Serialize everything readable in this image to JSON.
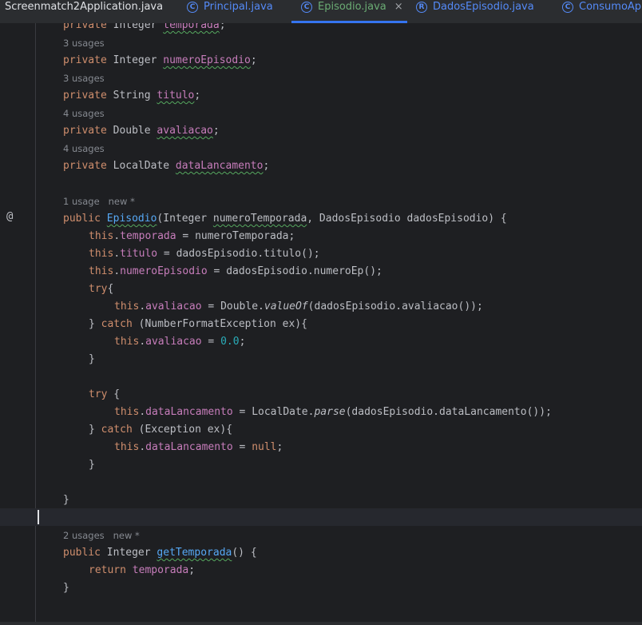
{
  "tabs": [
    {
      "label": "Screenmatch2Application.java",
      "icon": "",
      "state": "plain"
    },
    {
      "label": "Principal.java",
      "icon": "C",
      "state": "normal"
    },
    {
      "label": "Episodio.java",
      "icon": "C",
      "state": "active",
      "close": "×"
    },
    {
      "label": "DadosEpisodio.java",
      "icon": "R",
      "state": "normal"
    },
    {
      "label": "ConsumoApi",
      "icon": "C",
      "state": "normal"
    }
  ],
  "gutter": {
    "override_marker": "@"
  },
  "hints": {
    "u3": "3 usages",
    "u4": "4 usages",
    "ctor": "1 usage   new *",
    "getter": "2 usages   new *"
  },
  "code": {
    "l1_kw": "private",
    "l1_type": " Integer ",
    "l1_name": "temporada",
    "l1_end": ";",
    "l2_kw": "private",
    "l2_type": " Integer ",
    "l2_name": "numeroEpisodio",
    "l2_end": ";",
    "l3_kw": "private",
    "l3_type": " String ",
    "l3_name": "titulo",
    "l3_end": ";",
    "l4_kw": "private",
    "l4_type": " Double ",
    "l4_name": "avaliacao",
    "l4_end": ";",
    "l5_kw": "private",
    "l5_type": " LocalDate ",
    "l5_name": "dataLancamento",
    "l5_end": ";",
    "c_kw": "public",
    "c_sp": " ",
    "c_name": "Episodio",
    "c_p1": "(Integer ",
    "c_arg1": "numeroTemporada",
    "c_p2": ", DadosEpisodio dadosEpisodio) {",
    "a1_this": "this",
    "a1_dot": ".",
    "a1_fld": "temporada",
    "a1_rest": " = numeroTemporada;",
    "a2_this": "this",
    "a2_dot": ".",
    "a2_fld": "titulo",
    "a2_rest": " = dadosEpisodio.titulo();",
    "a3_this": "this",
    "a3_dot": ".",
    "a3_fld": "numeroEpisodio",
    "a3_rest": " = dadosEpisodio.numeroEp();",
    "try1": "try",
    "try1_b": "{",
    "t1_this": "this",
    "t1_dot": ".",
    "t1_fld": "avaliacao",
    "t1_a": " = Double.",
    "t1_m": "valueOf",
    "t1_rest": "(dadosEpisodio.avaliacao());",
    "catch1_a": "} ",
    "catch1_kw": "catch",
    "catch1_rest": " (NumberFormatException ex){",
    "cb1_this": "this",
    "cb1_dot": ".",
    "cb1_fld": "avaliacao",
    "cb1_eq": " = ",
    "cb1_num": "0.0",
    "cb1_end": ";",
    "close1": "}",
    "try2": "try",
    "try2_b": " {",
    "t2_this": "this",
    "t2_dot": ".",
    "t2_fld": "dataLancamento",
    "t2_a": " = LocalDate.",
    "t2_m": "parse",
    "t2_rest": "(dadosEpisodio.dataLancamento());",
    "catch2_a": "} ",
    "catch2_kw": "catch",
    "catch2_rest": " (Exception ex){",
    "cb2_this": "this",
    "cb2_dot": ".",
    "cb2_fld": "dataLancamento",
    "cb2_eq": " = ",
    "cb2_null": "null",
    "cb2_end": ";",
    "close2": "}",
    "close3": "}",
    "g_kw": "public",
    "g_type": " Integer ",
    "g_name": "getTemporada",
    "g_rest": "() {",
    "r_kw": "return",
    "r_sp": " ",
    "r_fld": "temporada",
    "r_end": ";",
    "close4": "}"
  }
}
